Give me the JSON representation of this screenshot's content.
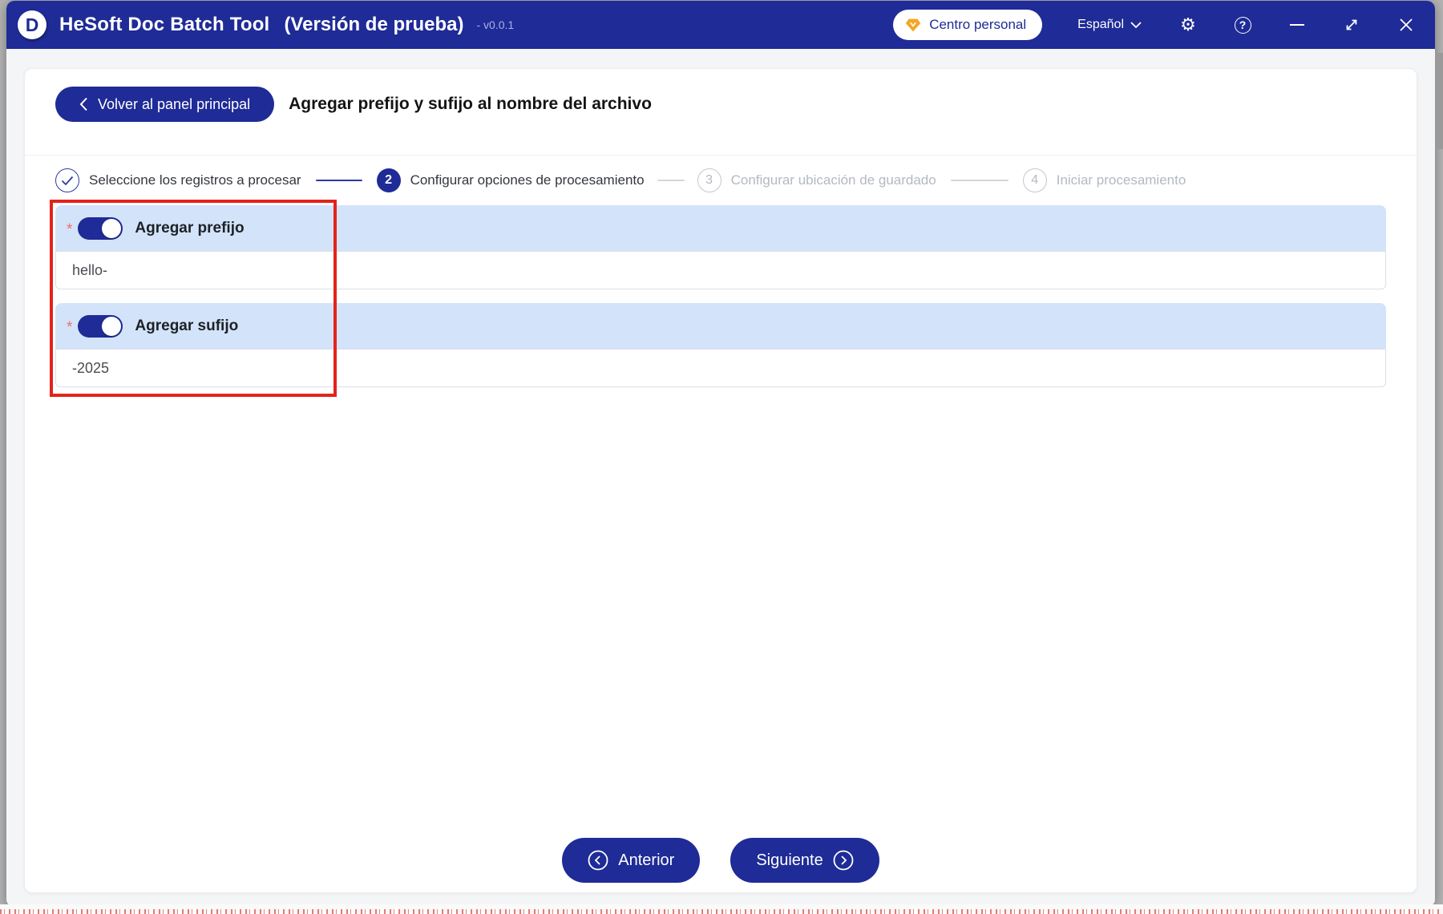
{
  "titlebar": {
    "logo_letter": "D",
    "app_title": "HeSoft Doc Batch Tool",
    "app_subtitle": "(Versión de prueba)",
    "version": "- v0.0.1",
    "personal_center_label": "Centro personal",
    "language_label": "Español"
  },
  "header": {
    "back_button_label": "Volver al panel principal",
    "page_title": "Agregar prefijo y sufijo al nombre del archivo"
  },
  "steps": [
    {
      "number": "1",
      "label": "Seleccione los registros a procesar",
      "state": "completed"
    },
    {
      "number": "2",
      "label": "Configurar opciones de procesamiento",
      "state": "active"
    },
    {
      "number": "3",
      "label": "Configurar ubicación de guardado",
      "state": "pending"
    },
    {
      "number": "4",
      "label": "Iniciar procesamiento",
      "state": "pending"
    }
  ],
  "form": {
    "prefix": {
      "required_marker": "*",
      "label": "Agregar prefijo",
      "enabled": true,
      "value": "hello-"
    },
    "suffix": {
      "required_marker": "*",
      "label": "Agregar sufijo",
      "enabled": true,
      "value": "-2025"
    }
  },
  "footer": {
    "previous_label": "Anterior",
    "next_label": "Siguiente"
  },
  "colors": {
    "primary": "#1f2b96",
    "section_header_bg": "#d3e3f9",
    "annotation_red": "#e3231a",
    "required_red": "#f56c6c",
    "step_inactive": "#b4b9c2",
    "personal_badge_gold": "#f5a623"
  }
}
